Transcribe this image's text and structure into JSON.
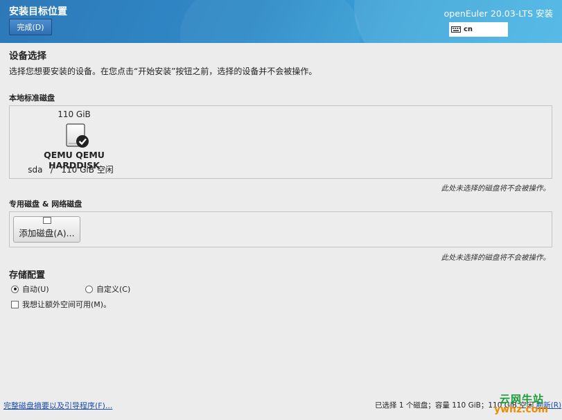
{
  "header": {
    "title": "安装目标位置",
    "done_label": "完成(D)",
    "product": "openEuler 20.03-LTS 安装",
    "keyboard_layout": "cn"
  },
  "device_section": {
    "title": "设备选择",
    "description": "选择您想要安装的设备。在您点击“开始安装”按钮之前，选择的设备并不会被操作。"
  },
  "local_disks": {
    "title": "本地标准磁盘",
    "disks": [
      {
        "size": "110 GiB",
        "name": "QEMU QEMU HARDDISK",
        "device": "sda",
        "separator": "/",
        "free": "110 GiB 空闲",
        "selected": true
      }
    ],
    "note": "此处未选择的磁盘将不会被操作。"
  },
  "special_disks": {
    "title": "专用磁盘 & 网络磁盘",
    "add_label": "添加磁盘(A)...",
    "note": "此处未选择的磁盘将不会被操作。"
  },
  "storage_config": {
    "title": "存储配置",
    "auto_label": "自动(U)",
    "custom_label": "自定义(C)",
    "extra_space_label": "我想让额外空间可用(M)。",
    "selected": "auto"
  },
  "footer": {
    "summary_link": "完整磁盘摘要以及引导程序(F)...",
    "status": "已选择 1 个磁盘；容量 110 GiB；110 GiB 空闲",
    "reset_link": "刷新(R)"
  },
  "watermark": {
    "line1": "云网牛站",
    "line2": "ywnz.com"
  },
  "colors": {
    "header_start": "#2e78b8",
    "header_end": "#44b4e4",
    "link": "#1a4bb5"
  }
}
